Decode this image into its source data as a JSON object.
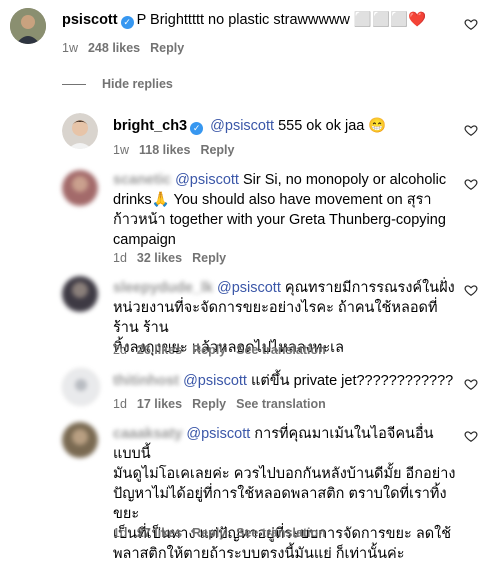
{
  "comments": [
    {
      "username": "psiscott",
      "text_suffix": "P Brighttttt no plastic strawwwww ",
      "emoji_tail": "⬜⬜⬜",
      "red_heart": "❤️",
      "time": "1w",
      "likes": "248 likes",
      "reply": "Reply"
    }
  ],
  "hide_replies": "Hide replies",
  "replies": [
    {
      "username": "bright_ch3",
      "mention": "@psiscott",
      "text": " 555 ok ok jaa ",
      "emoji": "😁",
      "time": "1w",
      "likes": "118 likes",
      "reply": "Reply"
    },
    {
      "username": "scanetic",
      "mention": "@psiscott",
      "lines": [
        " Sir Si, no monopoly or alcoholic",
        "drinks🙏 You should also have movement on สุรา",
        "ก้าวหน้า together with your Greta Thunberg-copying",
        "campaign"
      ],
      "time": "1d",
      "likes": "32 likes",
      "reply": "Reply"
    },
    {
      "username": "sleepydude_lk",
      "mention": "@psiscott",
      "lines": [
        " คุณทรายมีการรณรงค์ในฝั่ง",
        "หน่วยงานที่จะจัดการขยะอย่างไรคะ ถ้าคนใช้หลอดที่ร้าน ร้าน",
        "ทิ้งลงถุงขยะ แล้วหลอดไปไหลลงทะเล"
      ],
      "time": "2d",
      "likes": "26 likes",
      "reply": "Reply",
      "translate": "See translation"
    },
    {
      "username": "thitinhost",
      "mention": "@psiscott",
      "lines": [
        " แต่ขึ้น private jet????????????"
      ],
      "time": "1d",
      "likes": "17 likes",
      "reply": "Reply",
      "translate": "See translation"
    },
    {
      "username": "caaaksaty",
      "mention": "@psiscott",
      "lines": [
        " การที่คุณมาเม้นในไอจีคนอื่นแบบนี้",
        "มันดูไม่โอเคเลยค่ะ ควรไปบอกกันหลังบ้านดีมั้ย อีกอย่าง",
        "ปัญหาไม่ได้อยู่ที่การใช้หลอดพลาสติก ตราบใดที่เราทิ้งขยะ",
        "เป็นที่เป็นทาง แต่ปัญหาอยู่ที่ระบบการจัดการขยะ ลดใช้",
        "พลาสติกให้ตายถ้าระบบตรงนี้มันแย่ ก็เท่านั้นค่ะ"
      ],
      "time": "1d",
      "likes": "27 likes",
      "reply": "Reply",
      "translate": "See translation"
    }
  ],
  "colors": {
    "mention": "#3b57a8",
    "meta": "#737373",
    "verified": "#3797f0",
    "heart_red": "#e0245e"
  }
}
